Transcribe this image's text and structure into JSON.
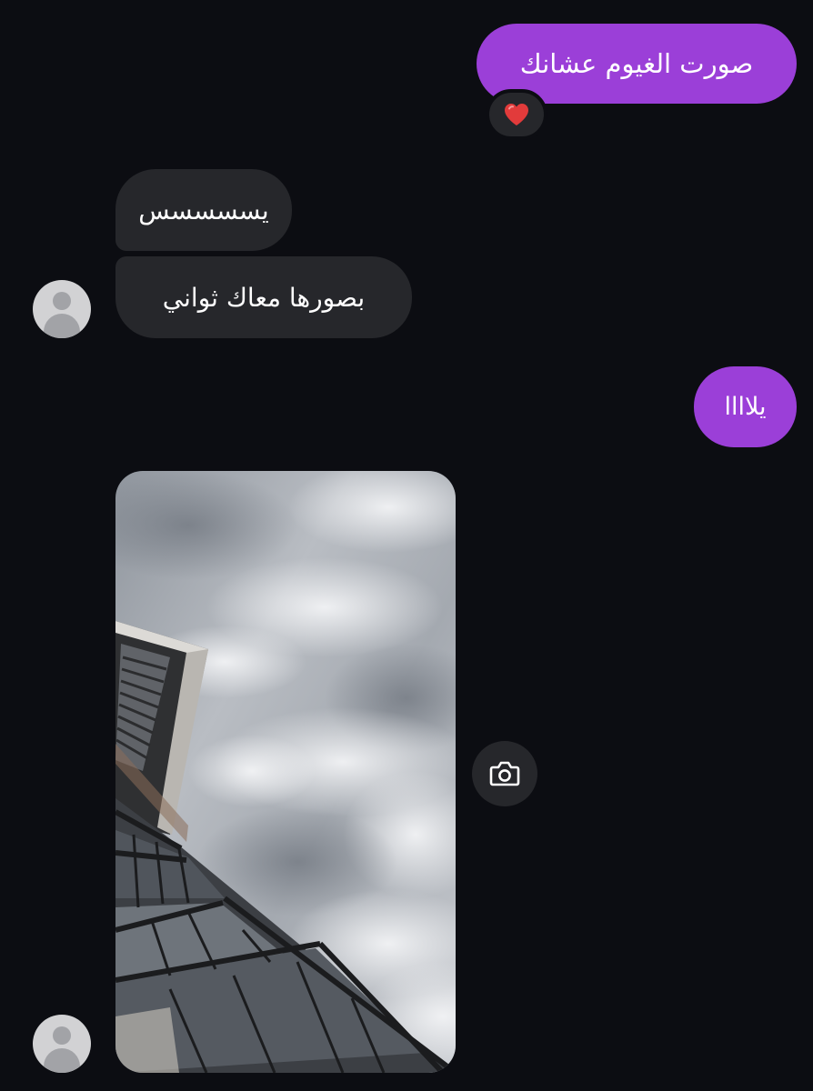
{
  "messages": {
    "sent_1": "صورت الغيوم عشانك",
    "received_1": "يسسسسس",
    "received_2": "بصورها معاك ثواني",
    "sent_2": "يلاااا"
  },
  "reaction": {
    "icon": "heart-icon",
    "color": "#e23b3b"
  },
  "colors": {
    "background": "#0c0d12",
    "sent_bubble": "#9b3fd8",
    "received_bubble": "#26272b",
    "text": "#ffffff"
  },
  "icons": {
    "avatar": "default-avatar-icon",
    "camera": "camera-icon"
  }
}
